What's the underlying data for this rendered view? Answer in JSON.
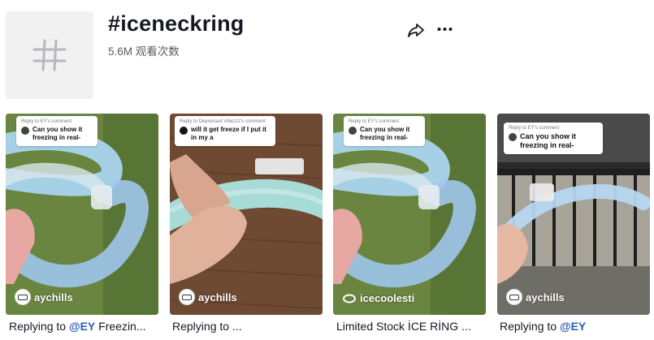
{
  "header": {
    "title": "#iceneckring",
    "views": "5.6M 观看次数"
  },
  "icons": {
    "hashtag": "hashtag-icon",
    "share": "share-arrow-icon",
    "more": "more-dots-icon"
  },
  "videos": [
    {
      "comment_head": "Reply to EY's comment",
      "comment_text": "Can you show it freezing in real-",
      "watermark": "aychills",
      "caption_prefix": "Replying to ",
      "caption_mention": "@EY",
      "caption_suffix": " Freezin..."
    },
    {
      "comment_head": "Reply to Depressed Vibezzz's comment",
      "comment_text": "will it get freeze if I put it in my a",
      "watermark": "aychills",
      "caption_prefix": "Replying to ...",
      "caption_mention": "",
      "caption_suffix": ""
    },
    {
      "comment_head": "Reply to EY's comment",
      "comment_text": "Can you show it freezing in real-",
      "watermark": "icecoolesti",
      "caption_prefix": "Limited Stock İCE RİNG ...",
      "caption_mention": "",
      "caption_suffix": ""
    },
    {
      "comment_head": "Reply to EY's comment",
      "comment_text": "Can you show it freezing in real-",
      "watermark": "aychills",
      "caption_prefix": "Replying to ",
      "caption_mention": "@EY",
      "caption_suffix": ""
    }
  ],
  "colors": {
    "title": "#161823",
    "secondary_text": "#5b5c63",
    "mention": "#2b5db9",
    "ring_blue": "#a9d4ef"
  }
}
